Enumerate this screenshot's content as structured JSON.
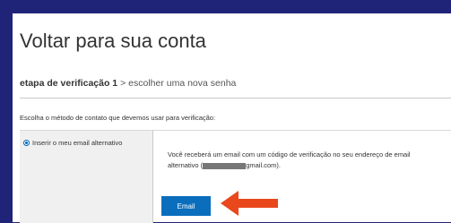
{
  "page": {
    "title": "Voltar para sua conta"
  },
  "breadcrumb": {
    "current": "etapa de verificação 1",
    "separator": ">",
    "next": "escolher uma nova senha"
  },
  "instruction": "Escolha o método de contato que devemos usar para verificação:",
  "methods": [
    {
      "label": "Inserir o meu email alternativo",
      "selected": true
    }
  ],
  "description": {
    "line1": "Você receberá um email com um código de verificação no seu endereço de email",
    "line2_prefix": "alternativo (",
    "email_visible": "gmail.com).",
    "masked": true
  },
  "button": {
    "label": "Email"
  },
  "colors": {
    "background": "#1f2478",
    "accent_button": "#0a6ebd",
    "arrow": "#e8481c"
  },
  "icons": {
    "arrow": "left-arrow-icon"
  }
}
